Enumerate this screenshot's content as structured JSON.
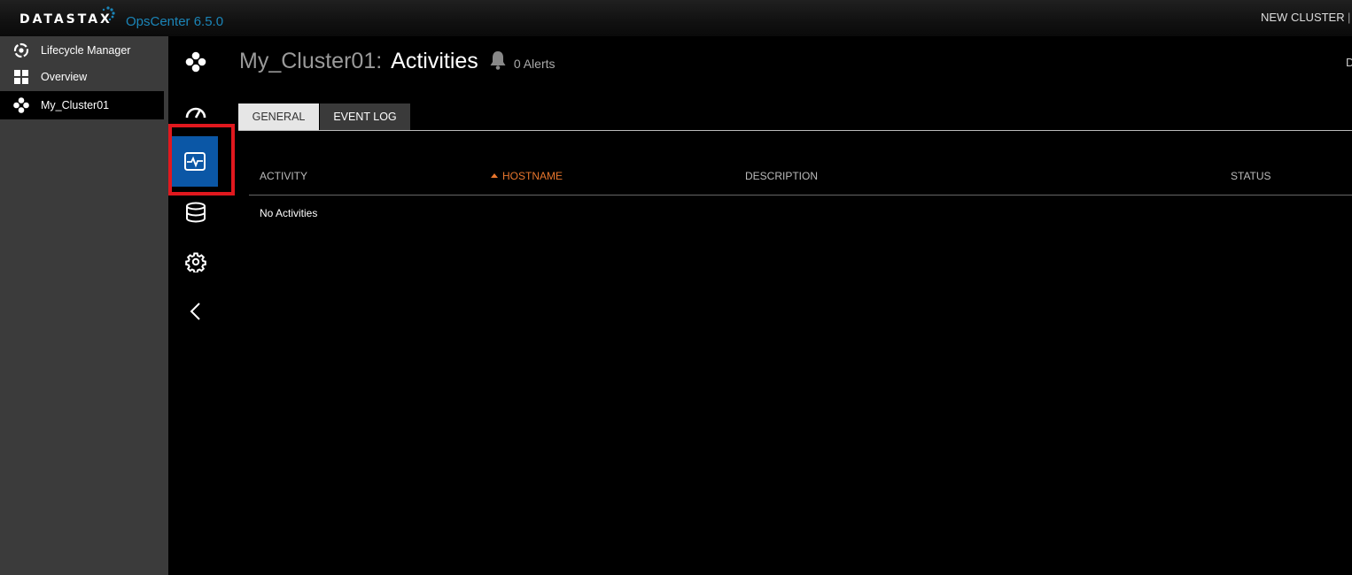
{
  "header": {
    "brand": "DATASTAX",
    "product": "OpsCenter 6.5.0",
    "new_cluster": "NEW CLUSTER",
    "separator": "|"
  },
  "sidebar": {
    "items": [
      {
        "label": "Lifecycle Manager",
        "icon": "lifecycle-icon"
      },
      {
        "label": "Overview",
        "icon": "grid-icon"
      },
      {
        "label": "My_Cluster01",
        "icon": "cluster-icon",
        "active": true
      }
    ]
  },
  "rail": {
    "items": [
      {
        "icon": "cluster-icon"
      },
      {
        "icon": "dashboard-gauge-icon"
      },
      {
        "icon": "activity-monitor-icon",
        "selected": true
      },
      {
        "icon": "database-icon"
      },
      {
        "icon": "gear-icon"
      },
      {
        "icon": "chevron-left-icon"
      }
    ]
  },
  "page": {
    "cluster": "My_Cluster01:",
    "title": "Activities",
    "alerts": "0 Alerts",
    "right_cut": "D"
  },
  "tabs": [
    {
      "label": "GENERAL",
      "active": true
    },
    {
      "label": "EVENT LOG",
      "active": false
    }
  ],
  "table": {
    "columns": [
      "ACTIVITY",
      "HOSTNAME",
      "DESCRIPTION",
      "STATUS"
    ],
    "sorted_column": "HOSTNAME",
    "empty_text": "No Activities"
  },
  "colors": {
    "accent": "#0b57a6",
    "sort_highlight": "#e8762d",
    "brand_blue": "#1b85b8",
    "highlight_box": "#e1181e"
  }
}
